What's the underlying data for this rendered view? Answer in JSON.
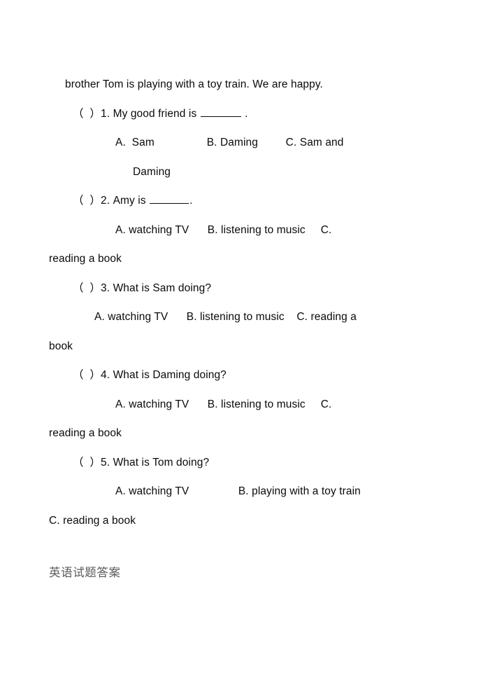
{
  "document": {
    "type": "english-exam-worksheet",
    "background_color": "#ffffff",
    "text_color": "#0a0a0a",
    "heading_color": "#5a5a5a",
    "passage_tail": "brother Tom is playing with a toy train. We are happy.",
    "questions": [
      {
        "marker": "（  ）",
        "number": "1.",
        "stem_before_blank": " My good friend is ",
        "has_blank": true,
        "stem_after_blank": " .",
        "options_line": "A.  Sam                 B. Daming         C. Sam and",
        "options_wrap": "Daming"
      },
      {
        "marker": "（  ）",
        "number": "2.",
        "stem_before_blank": " Amy is ",
        "has_blank": true,
        "stem_after_blank": ".",
        "options_line": "A. watching TV      B. listening to music     C.",
        "options_wrap": "reading a book"
      },
      {
        "marker": "（  ）",
        "number": "3.",
        "stem_before_blank": " What is Sam doing?",
        "has_blank": false,
        "stem_after_blank": "",
        "options_line": "A. watching TV      B. listening to music    C. reading a",
        "options_wrap": "book"
      },
      {
        "marker": "（  ）",
        "number": "4.",
        "stem_before_blank": " What is Daming doing?",
        "has_blank": false,
        "stem_after_blank": "",
        "options_line": "A. watching TV      B. listening to music     C.",
        "options_wrap": "reading a book"
      },
      {
        "marker": "（  ）",
        "number": "5.",
        "stem_before_blank": " What is Tom doing?",
        "has_blank": false,
        "stem_after_blank": "",
        "options_line": "A. watching TV                B. playing with a toy train",
        "options_wrap": "C. reading a book"
      }
    ],
    "answers_heading": "英语试题答案"
  }
}
